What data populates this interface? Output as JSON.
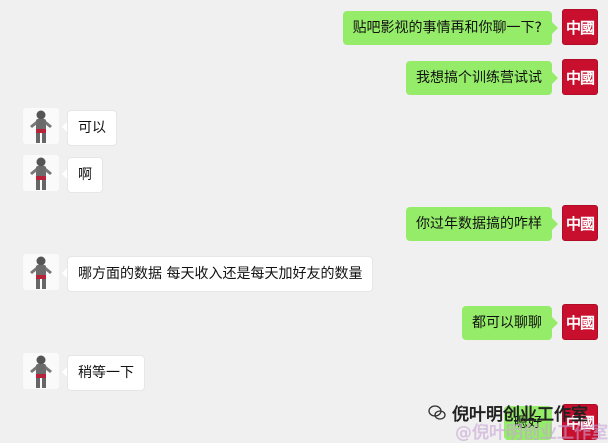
{
  "conversation": {
    "messages": [
      {
        "side": "me",
        "text": "贴吧影视的事情再和你聊一下?"
      },
      {
        "side": "me",
        "text": "我想搞个训练营试试"
      },
      {
        "side": "other",
        "text": "可以"
      },
      {
        "side": "other",
        "text": "啊"
      },
      {
        "side": "me",
        "text": "你过年数据搞的咋样"
      },
      {
        "side": "other",
        "text": "哪方面的数据 每天收入还是每天加好友的数量"
      },
      {
        "side": "me",
        "text": "都可以聊聊"
      },
      {
        "side": "other",
        "text": "稍等一下"
      },
      {
        "side": "me",
        "text": "嗯好"
      }
    ],
    "my_avatar_label": "中國",
    "other_avatar_name": "robot-figure-avatar"
  },
  "watermark": {
    "text": "倪叶明创业工作室",
    "faded_text": "@倪叶明创业工作室"
  },
  "colors": {
    "background": "#f0f0f0",
    "my_bubble": "#95ec69",
    "other_bubble": "#ffffff",
    "avatar_red": "#c8102e"
  }
}
